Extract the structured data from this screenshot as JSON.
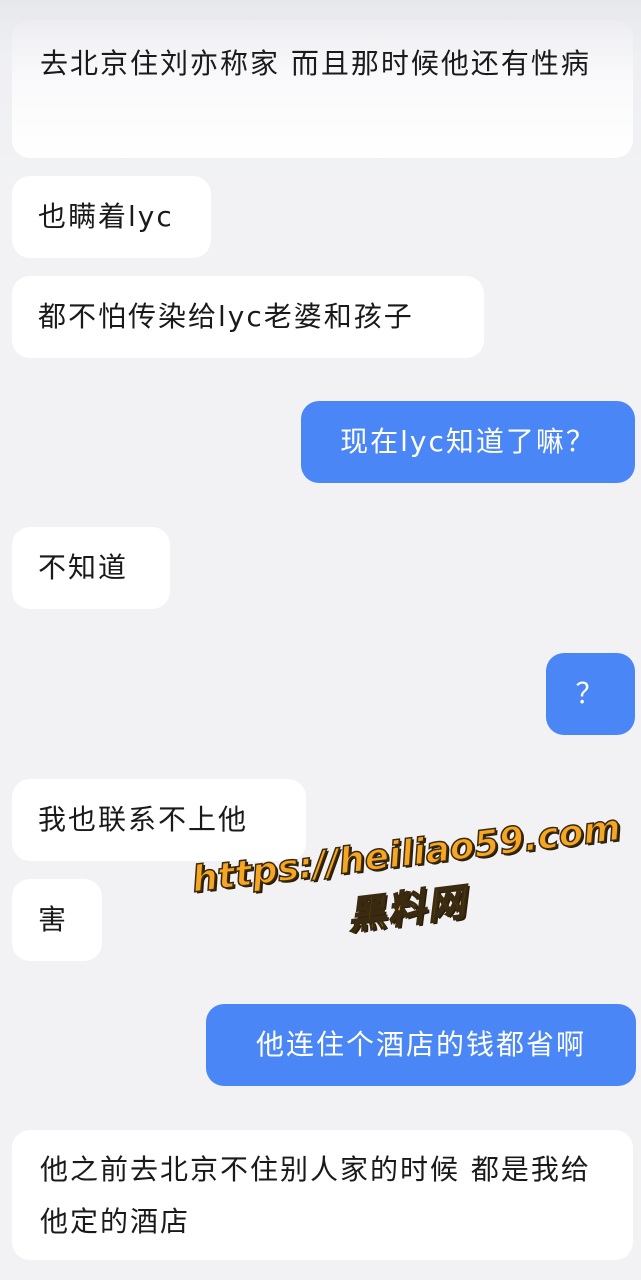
{
  "messages": [
    {
      "id": "m1",
      "side": "received",
      "text": "去北京住刘亦称家  而且那时候他还有性病"
    },
    {
      "id": "m2",
      "side": "received",
      "text": "也瞒着lyc"
    },
    {
      "id": "m3",
      "side": "received",
      "text": "都不怕传染给lyc老婆和孩子"
    },
    {
      "id": "m4",
      "side": "sent",
      "text": "现在lyc知道了嘛？"
    },
    {
      "id": "m5",
      "side": "received",
      "text": "不知道"
    },
    {
      "id": "m6",
      "side": "sent",
      "text": "？"
    },
    {
      "id": "m7",
      "side": "received",
      "text": "我也联系不上他"
    },
    {
      "id": "m8",
      "side": "received",
      "text": "害"
    },
    {
      "id": "m9",
      "side": "sent",
      "text": "他连住个酒店的钱都省啊"
    },
    {
      "id": "m10",
      "side": "received",
      "text": "他之前去北京不住别人家的时候  都是我给他定的酒店"
    }
  ],
  "watermark": {
    "url": "https://heiliao59.com",
    "name": "黑料网"
  },
  "colors": {
    "sent_bubble": "#4a86f5",
    "received_bubble": "#ffffff",
    "background": "#f2f2f5",
    "watermark": "#f6a623"
  }
}
